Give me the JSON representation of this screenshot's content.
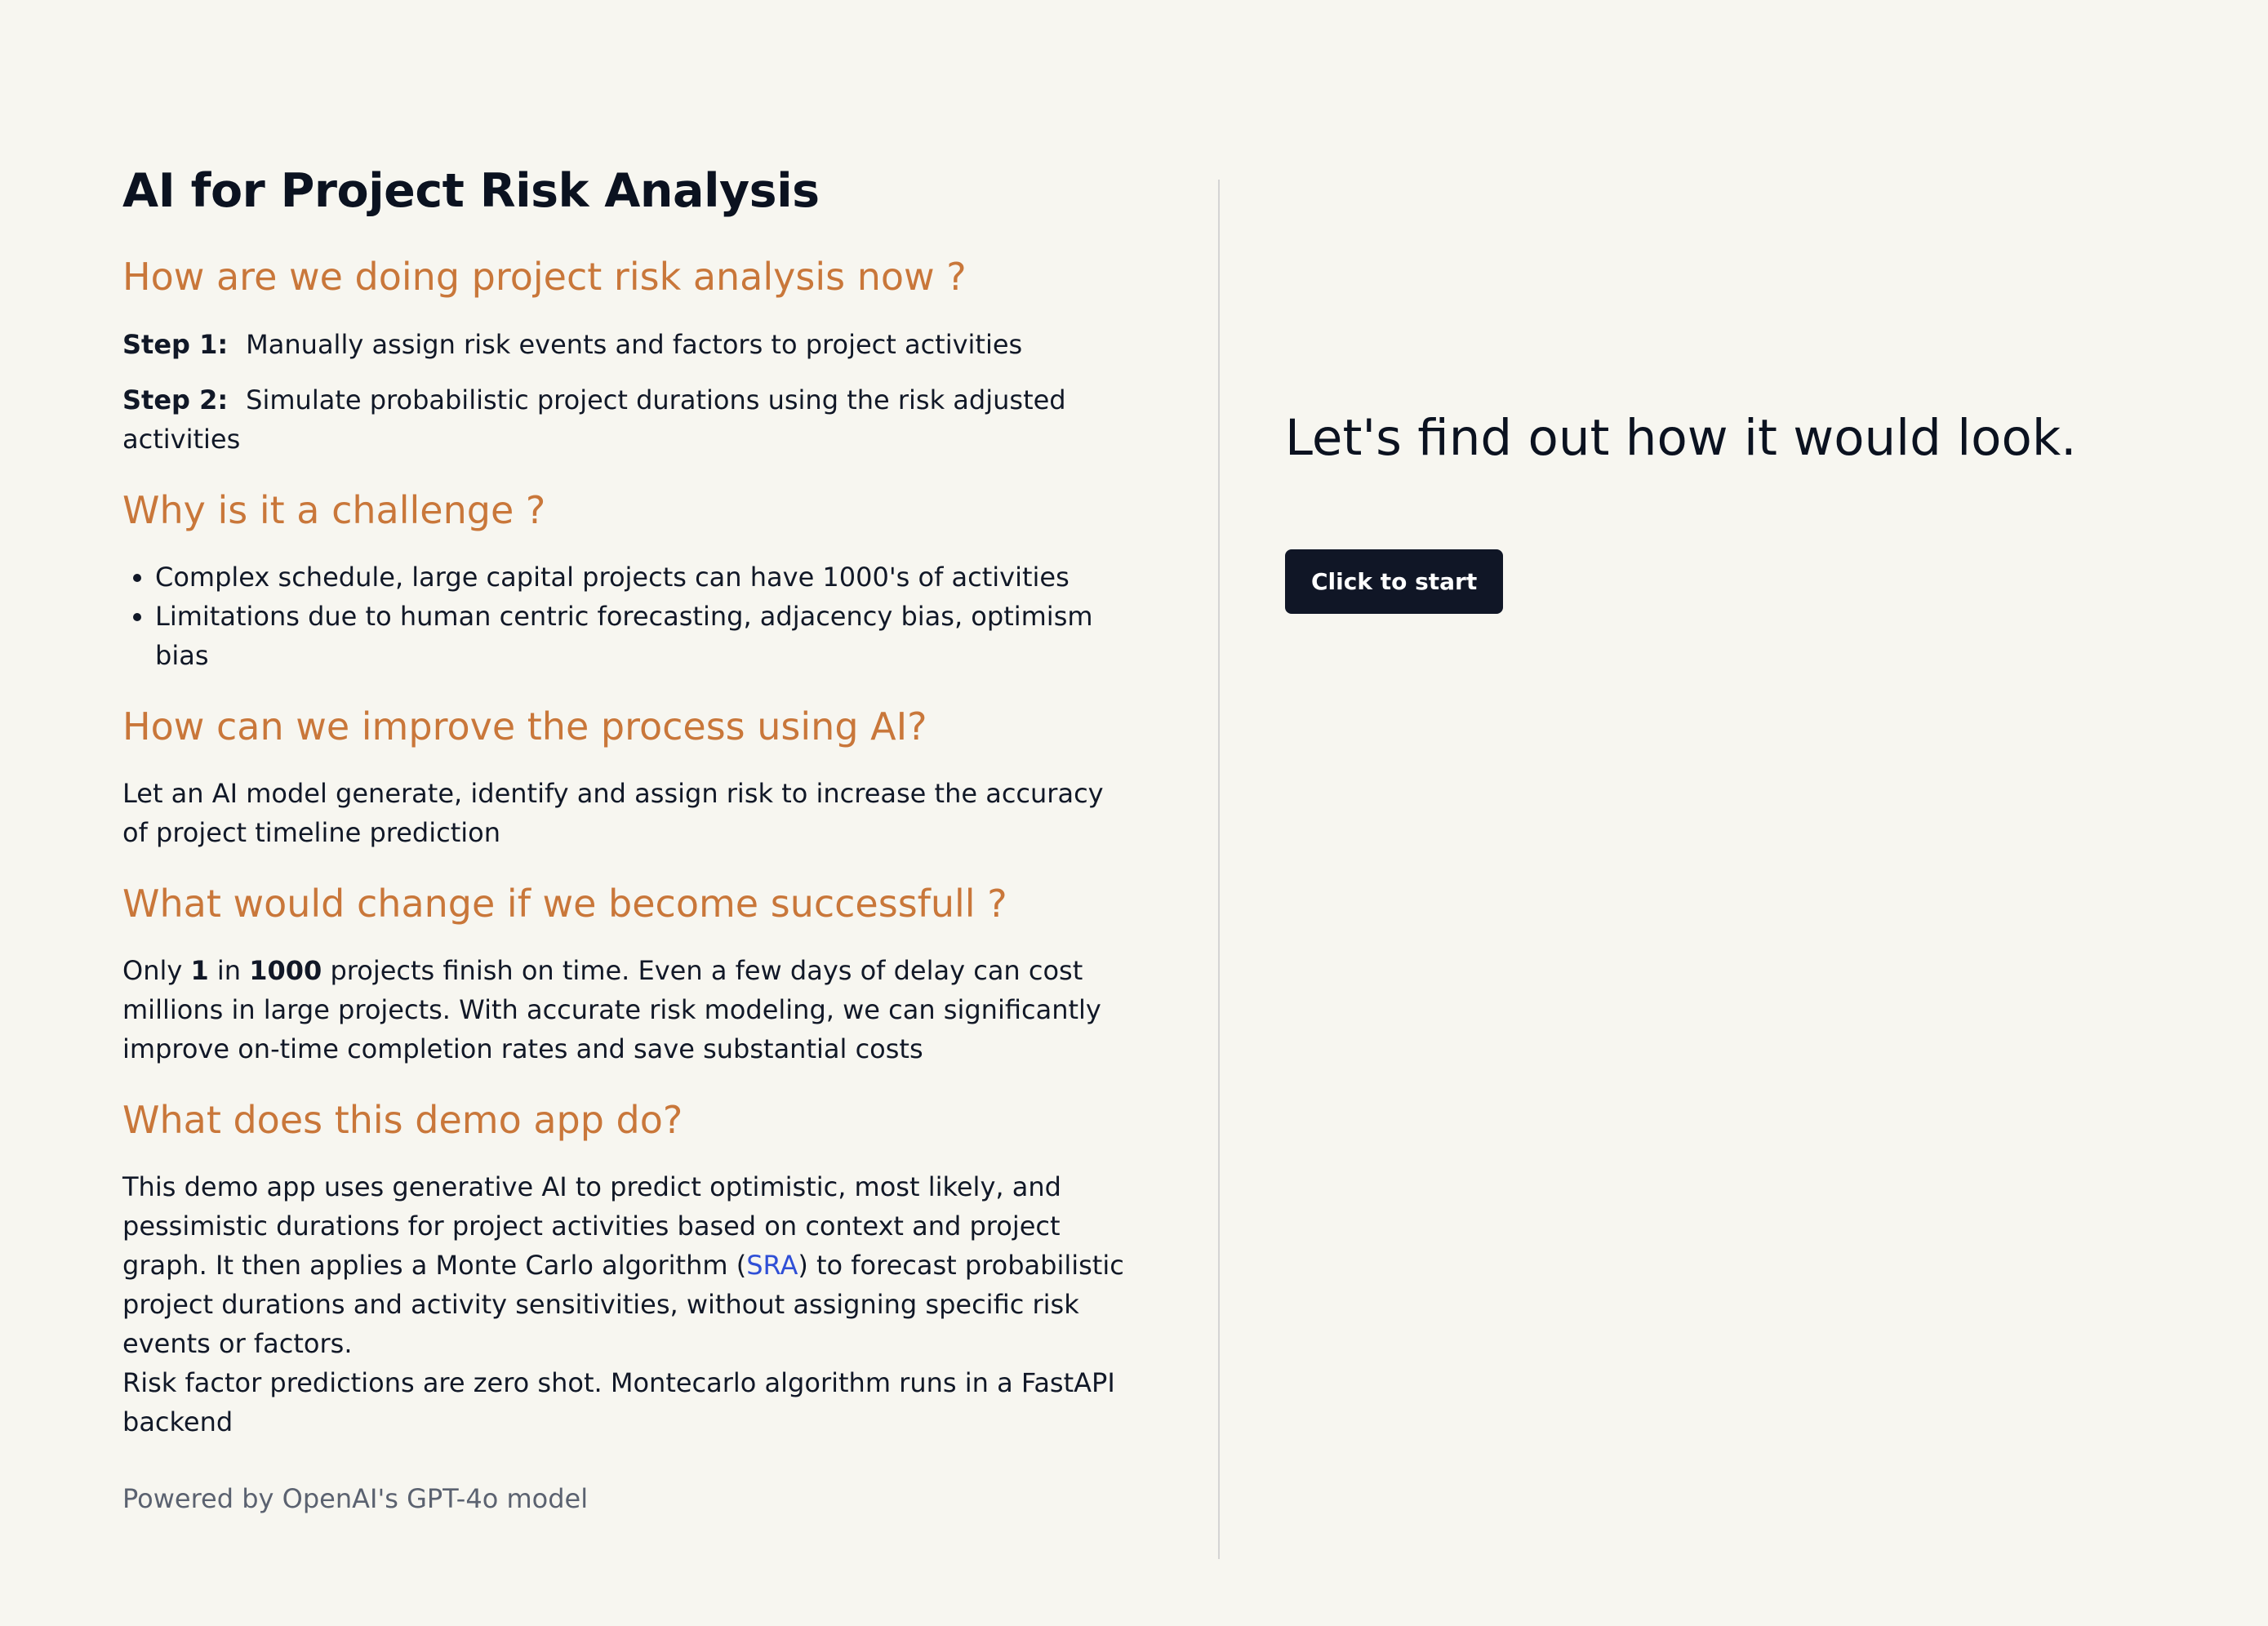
{
  "title": "AI for Project Risk Analysis",
  "sections": {
    "now": {
      "heading": "How are we doing project risk analysis now ?",
      "step1_label": "Step 1:",
      "step1_text": "Manually assign risk events and factors to project activities",
      "step2_label": "Step 2:",
      "step2_text": "Simulate probabilistic project durations using the risk adjusted activities"
    },
    "challenge": {
      "heading": "Why is it a challenge ?",
      "bullets": [
        "Complex schedule, large capital projects can have 1000's of activities",
        "Limitations due to human centric forecasting, adjacency bias, optimism bias"
      ]
    },
    "improve": {
      "heading": "How can we improve the process using AI?",
      "text": "Let an AI model generate, identify and assign risk to increase the accuracy of project timeline prediction"
    },
    "change": {
      "heading": "What would change if we become successfull ?",
      "text_a": "Only ",
      "num_a": "1",
      "text_b": " in ",
      "num_b": "1000",
      "text_c": " projects finish on time. Even a few days of delay can cost millions in large projects. With accurate risk modeling, we can significantly improve on-time completion rates and save substantial costs"
    },
    "demo": {
      "heading": "What does this demo app do?",
      "text_a": "This demo app uses generative AI to predict optimistic, most likely, and pessimistic durations for project activities based on context and project graph. It then applies a Monte Carlo algorithm (",
      "link": "SRA",
      "text_b": ") to forecast probabilistic project durations and activity sensitivities, without assigning specific risk events or factors.",
      "text_c": "Risk factor predictions are zero shot. Montecarlo algorithm runs in a FastAPI backend"
    }
  },
  "footer": {
    "powered": "Powered by OpenAI's GPT-4o model"
  },
  "cta": {
    "title": "Let's find out how it would look.",
    "button_label": "Click to start"
  },
  "colors": {
    "background": "#f7f6f0",
    "heading_accent": "#c9773a",
    "link": "#2f4fd6",
    "button_bg": "#101626",
    "divider": "#d4d4d4"
  }
}
